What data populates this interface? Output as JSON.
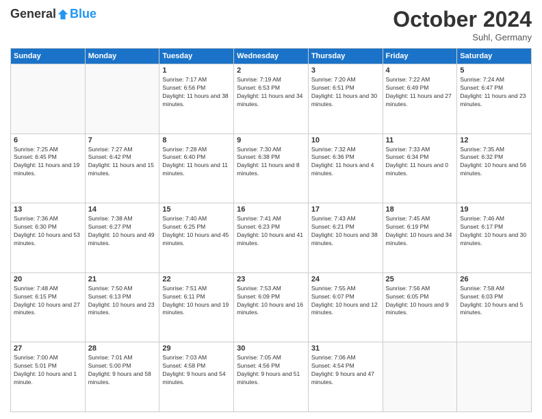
{
  "header": {
    "logo_general": "General",
    "logo_blue": "Blue",
    "month_title": "October 2024",
    "location": "Suhl, Germany"
  },
  "days_of_week": [
    "Sunday",
    "Monday",
    "Tuesday",
    "Wednesday",
    "Thursday",
    "Friday",
    "Saturday"
  ],
  "weeks": [
    [
      {
        "day": "",
        "sunrise": "",
        "sunset": "",
        "daylight": ""
      },
      {
        "day": "",
        "sunrise": "",
        "sunset": "",
        "daylight": ""
      },
      {
        "day": "1",
        "sunrise": "Sunrise: 7:17 AM",
        "sunset": "Sunset: 6:56 PM",
        "daylight": "Daylight: 11 hours and 38 minutes."
      },
      {
        "day": "2",
        "sunrise": "Sunrise: 7:19 AM",
        "sunset": "Sunset: 6:53 PM",
        "daylight": "Daylight: 11 hours and 34 minutes."
      },
      {
        "day": "3",
        "sunrise": "Sunrise: 7:20 AM",
        "sunset": "Sunset: 6:51 PM",
        "daylight": "Daylight: 11 hours and 30 minutes."
      },
      {
        "day": "4",
        "sunrise": "Sunrise: 7:22 AM",
        "sunset": "Sunset: 6:49 PM",
        "daylight": "Daylight: 11 hours and 27 minutes."
      },
      {
        "day": "5",
        "sunrise": "Sunrise: 7:24 AM",
        "sunset": "Sunset: 6:47 PM",
        "daylight": "Daylight: 11 hours and 23 minutes."
      }
    ],
    [
      {
        "day": "6",
        "sunrise": "Sunrise: 7:25 AM",
        "sunset": "Sunset: 6:45 PM",
        "daylight": "Daylight: 11 hours and 19 minutes."
      },
      {
        "day": "7",
        "sunrise": "Sunrise: 7:27 AM",
        "sunset": "Sunset: 6:42 PM",
        "daylight": "Daylight: 11 hours and 15 minutes."
      },
      {
        "day": "8",
        "sunrise": "Sunrise: 7:28 AM",
        "sunset": "Sunset: 6:40 PM",
        "daylight": "Daylight: 11 hours and 11 minutes."
      },
      {
        "day": "9",
        "sunrise": "Sunrise: 7:30 AM",
        "sunset": "Sunset: 6:38 PM",
        "daylight": "Daylight: 11 hours and 8 minutes."
      },
      {
        "day": "10",
        "sunrise": "Sunrise: 7:32 AM",
        "sunset": "Sunset: 6:36 PM",
        "daylight": "Daylight: 11 hours and 4 minutes."
      },
      {
        "day": "11",
        "sunrise": "Sunrise: 7:33 AM",
        "sunset": "Sunset: 6:34 PM",
        "daylight": "Daylight: 11 hours and 0 minutes."
      },
      {
        "day": "12",
        "sunrise": "Sunrise: 7:35 AM",
        "sunset": "Sunset: 6:32 PM",
        "daylight": "Daylight: 10 hours and 56 minutes."
      }
    ],
    [
      {
        "day": "13",
        "sunrise": "Sunrise: 7:36 AM",
        "sunset": "Sunset: 6:30 PM",
        "daylight": "Daylight: 10 hours and 53 minutes."
      },
      {
        "day": "14",
        "sunrise": "Sunrise: 7:38 AM",
        "sunset": "Sunset: 6:27 PM",
        "daylight": "Daylight: 10 hours and 49 minutes."
      },
      {
        "day": "15",
        "sunrise": "Sunrise: 7:40 AM",
        "sunset": "Sunset: 6:25 PM",
        "daylight": "Daylight: 10 hours and 45 minutes."
      },
      {
        "day": "16",
        "sunrise": "Sunrise: 7:41 AM",
        "sunset": "Sunset: 6:23 PM",
        "daylight": "Daylight: 10 hours and 41 minutes."
      },
      {
        "day": "17",
        "sunrise": "Sunrise: 7:43 AM",
        "sunset": "Sunset: 6:21 PM",
        "daylight": "Daylight: 10 hours and 38 minutes."
      },
      {
        "day": "18",
        "sunrise": "Sunrise: 7:45 AM",
        "sunset": "Sunset: 6:19 PM",
        "daylight": "Daylight: 10 hours and 34 minutes."
      },
      {
        "day": "19",
        "sunrise": "Sunrise: 7:46 AM",
        "sunset": "Sunset: 6:17 PM",
        "daylight": "Daylight: 10 hours and 30 minutes."
      }
    ],
    [
      {
        "day": "20",
        "sunrise": "Sunrise: 7:48 AM",
        "sunset": "Sunset: 6:15 PM",
        "daylight": "Daylight: 10 hours and 27 minutes."
      },
      {
        "day": "21",
        "sunrise": "Sunrise: 7:50 AM",
        "sunset": "Sunset: 6:13 PM",
        "daylight": "Daylight: 10 hours and 23 minutes."
      },
      {
        "day": "22",
        "sunrise": "Sunrise: 7:51 AM",
        "sunset": "Sunset: 6:11 PM",
        "daylight": "Daylight: 10 hours and 19 minutes."
      },
      {
        "day": "23",
        "sunrise": "Sunrise: 7:53 AM",
        "sunset": "Sunset: 6:09 PM",
        "daylight": "Daylight: 10 hours and 16 minutes."
      },
      {
        "day": "24",
        "sunrise": "Sunrise: 7:55 AM",
        "sunset": "Sunset: 6:07 PM",
        "daylight": "Daylight: 10 hours and 12 minutes."
      },
      {
        "day": "25",
        "sunrise": "Sunrise: 7:56 AM",
        "sunset": "Sunset: 6:05 PM",
        "daylight": "Daylight: 10 hours and 9 minutes."
      },
      {
        "day": "26",
        "sunrise": "Sunrise: 7:58 AM",
        "sunset": "Sunset: 6:03 PM",
        "daylight": "Daylight: 10 hours and 5 minutes."
      }
    ],
    [
      {
        "day": "27",
        "sunrise": "Sunrise: 7:00 AM",
        "sunset": "Sunset: 5:01 PM",
        "daylight": "Daylight: 10 hours and 1 minute."
      },
      {
        "day": "28",
        "sunrise": "Sunrise: 7:01 AM",
        "sunset": "Sunset: 5:00 PM",
        "daylight": "Daylight: 9 hours and 58 minutes."
      },
      {
        "day": "29",
        "sunrise": "Sunrise: 7:03 AM",
        "sunset": "Sunset: 4:58 PM",
        "daylight": "Daylight: 9 hours and 54 minutes."
      },
      {
        "day": "30",
        "sunrise": "Sunrise: 7:05 AM",
        "sunset": "Sunset: 4:56 PM",
        "daylight": "Daylight: 9 hours and 51 minutes."
      },
      {
        "day": "31",
        "sunrise": "Sunrise: 7:06 AM",
        "sunset": "Sunset: 4:54 PM",
        "daylight": "Daylight: 9 hours and 47 minutes."
      },
      {
        "day": "",
        "sunrise": "",
        "sunset": "",
        "daylight": ""
      },
      {
        "day": "",
        "sunrise": "",
        "sunset": "",
        "daylight": ""
      }
    ]
  ]
}
